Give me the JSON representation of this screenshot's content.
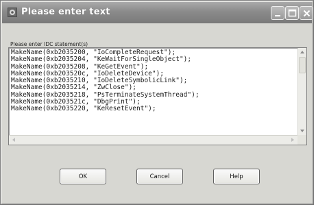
{
  "window": {
    "title": "Please enter text"
  },
  "prompt_label": "Please enter IDC statement(s)",
  "text_lines": [
    "MakeName(0xb2035200, \"IoCompleteRequest\");",
    "MakeName(0xb2035204, \"KeWaitForSingleObject\");",
    "MakeName(0xb2035208, \"KeGetEvent\");",
    "MakeName(0xb203520c, \"IoDeleteDevice\");",
    "MakeName(0xb2035210, \"IoDeleteSymbolicLink\");",
    "MakeName(0xb2035214, \"ZwClose\");",
    "MakeName(0xb2035218, \"PsTerminateSystemThread\");",
    "MakeName(0xb203521c, \"DbgPrint\");",
    "MakeName(0xb2035220, \"KeResetEvent\");"
  ],
  "buttons": {
    "ok": "OK",
    "cancel": "Cancel",
    "help": "Help"
  },
  "icons": {
    "app": "app-icon",
    "minimize": "minimize-icon",
    "maximize": "maximize-icon",
    "close": "close-icon"
  },
  "colors": {
    "titlebar": "#8b8b8b",
    "dialog_face": "#d7d7d2",
    "text_background": "#ffffff"
  }
}
